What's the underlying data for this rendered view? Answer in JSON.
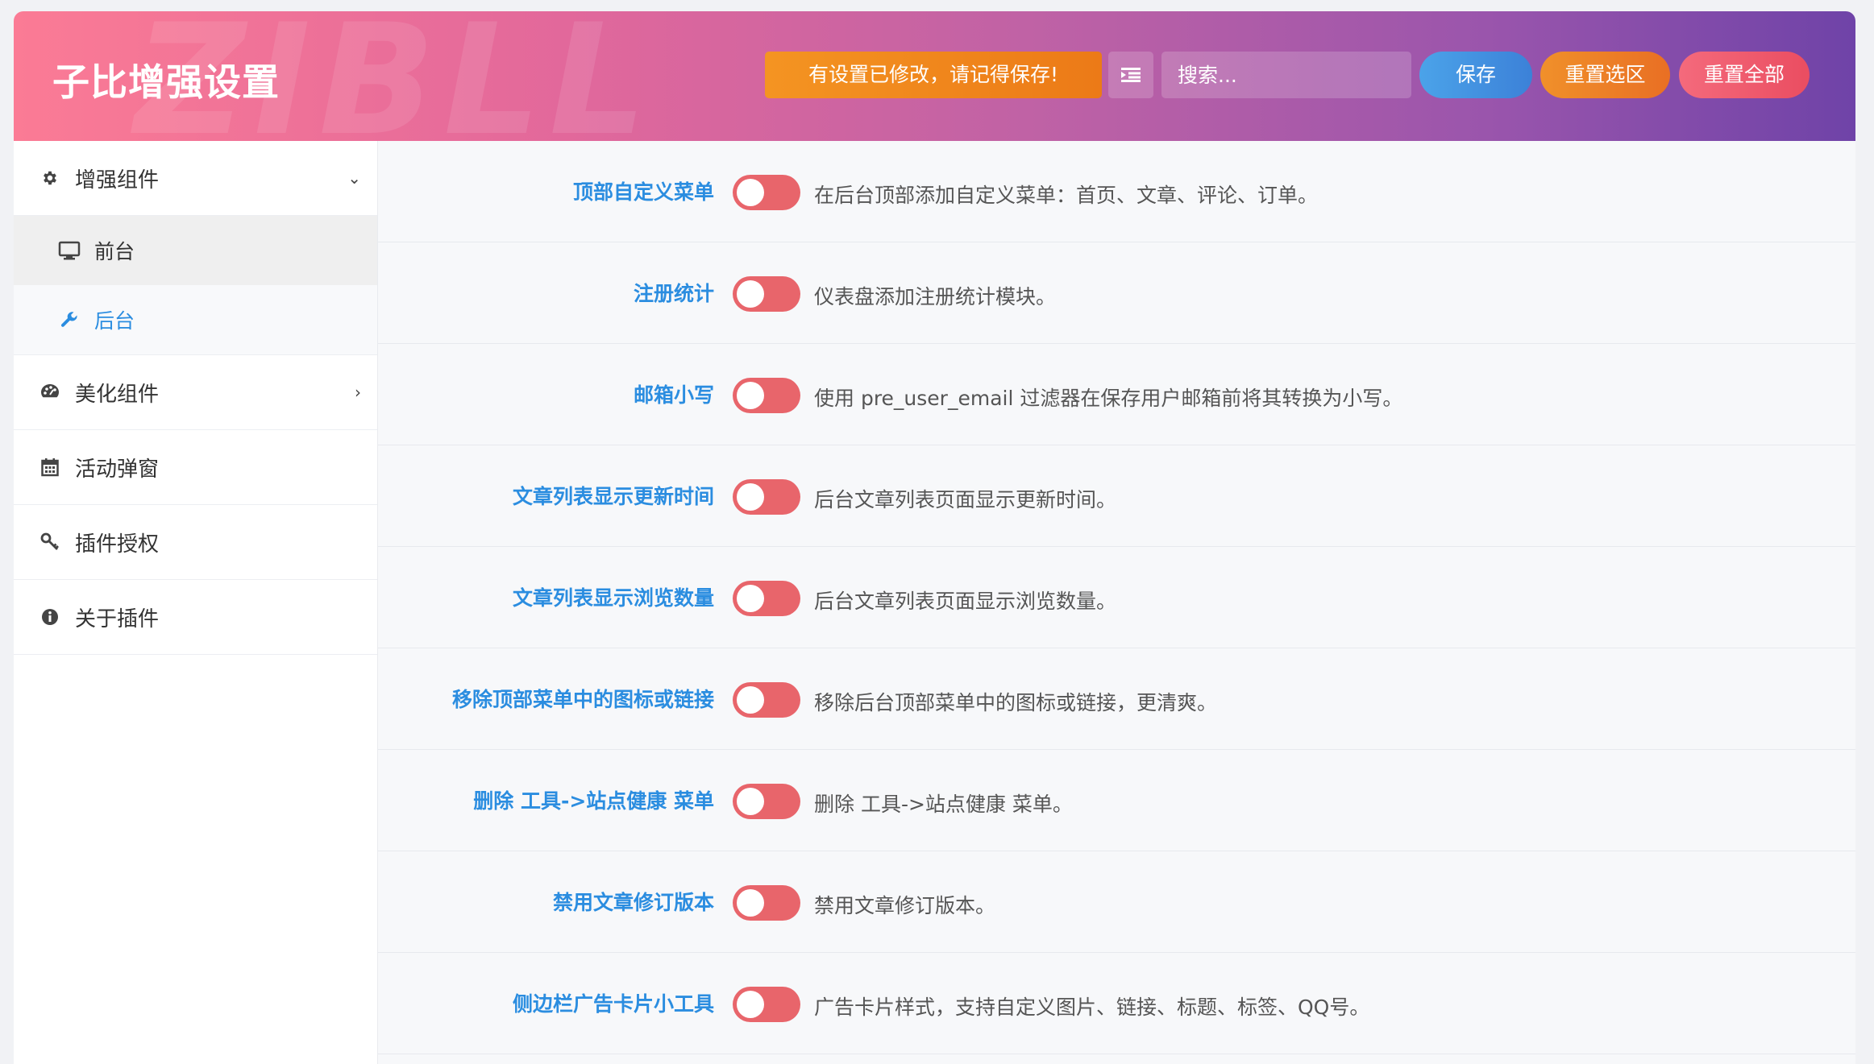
{
  "header": {
    "title": "子比增强设置",
    "watermark": "ZIBLL",
    "notice": "有设置已修改，请记得保存!",
    "search_placeholder": "搜索...",
    "save": "保存",
    "reset_section": "重置选区",
    "reset_all": "重置全部"
  },
  "sidebar": {
    "groups": [
      {
        "label": "增强组件",
        "icon": "gear-icon",
        "caret": "⌄"
      },
      {
        "label": "美化组件",
        "icon": "palette-icon",
        "caret": "›"
      },
      {
        "label": "活动弹窗",
        "icon": "calendar-icon"
      },
      {
        "label": "插件授权",
        "icon": "key-icon"
      },
      {
        "label": "关于插件",
        "icon": "info-icon"
      }
    ],
    "sub_items": [
      {
        "label": "前台",
        "icon": "monitor-icon"
      },
      {
        "label": "后台",
        "icon": "wrench-icon"
      }
    ]
  },
  "settings": [
    {
      "label": "顶部自定义菜单",
      "desc": "在后台顶部添加自定义菜单：首页、文章、评论、订单。",
      "enabled": false
    },
    {
      "label": "注册统计",
      "desc": "仪表盘添加注册统计模块。",
      "enabled": false
    },
    {
      "label": "邮箱小写",
      "desc": "使用 pre_user_email 过滤器在保存用户邮箱前将其转换为小写。",
      "enabled": false
    },
    {
      "label": "文章列表显示更新时间",
      "desc": "后台文章列表页面显示更新时间。",
      "enabled": false
    },
    {
      "label": "文章列表显示浏览数量",
      "desc": "后台文章列表页面显示浏览数量。",
      "enabled": false
    },
    {
      "label": "移除顶部菜单中的图标或链接",
      "desc": "移除后台顶部菜单中的图标或链接，更清爽。",
      "enabled": false
    },
    {
      "label": "删除 工具->站点健康 菜单",
      "desc": "删除 工具->站点健康 菜单。",
      "enabled": false
    },
    {
      "label": "禁用文章修订版本",
      "desc": "禁用文章修订版本。",
      "enabled": false
    },
    {
      "label": "侧边栏广告卡片小工具",
      "desc": "广告卡片样式，支持自定义图片、链接、标题、标签、QQ号。",
      "enabled": false
    }
  ],
  "colors": {
    "accent": "#2b8de0",
    "switch_off": "#e8656b",
    "notice": "#f08a1f"
  }
}
